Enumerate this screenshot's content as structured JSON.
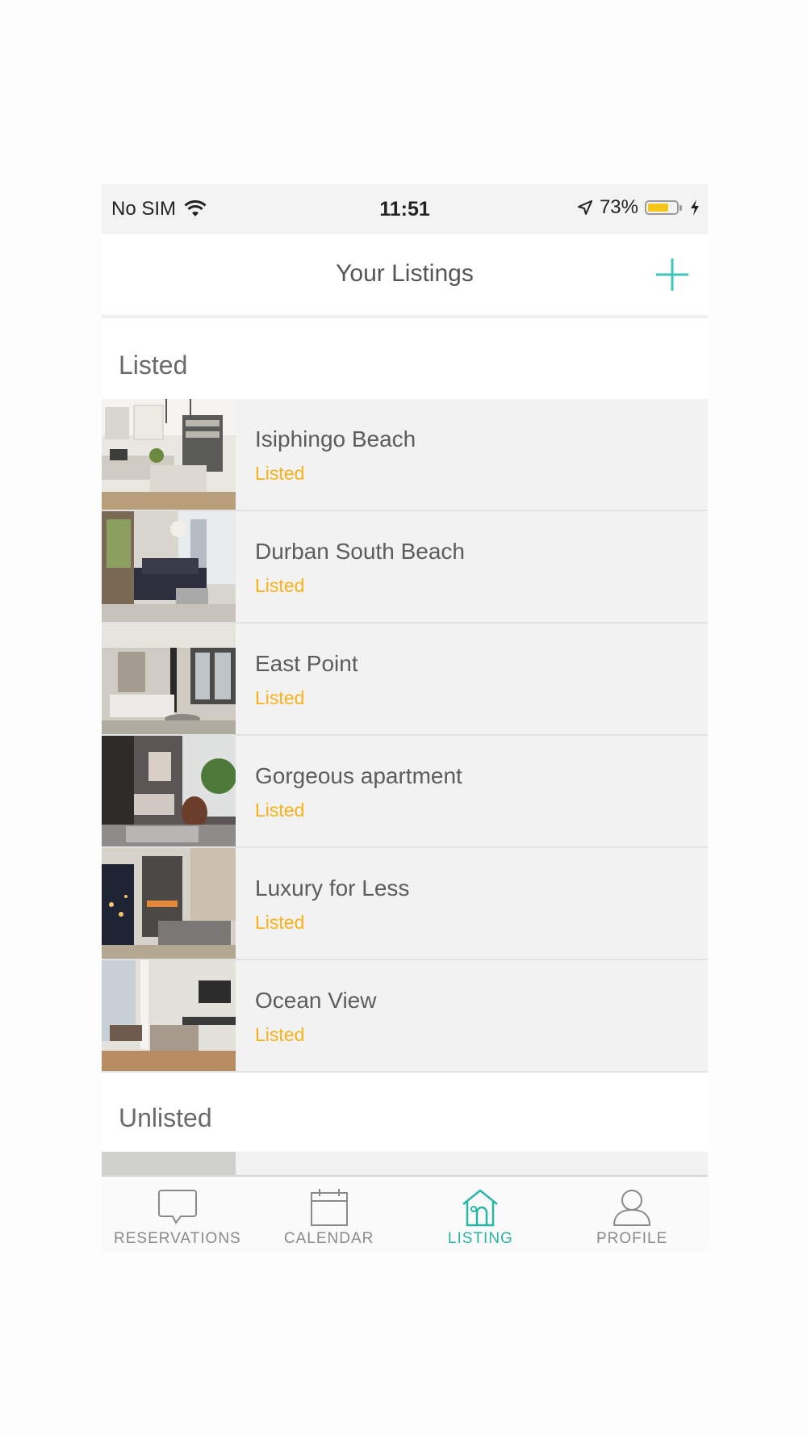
{
  "status_bar": {
    "carrier": "No SIM",
    "time": "11:51",
    "battery_percent": "73%",
    "battery_level": 0.73,
    "battery_color": "#f5c518"
  },
  "nav": {
    "title": "Your Listings",
    "add_icon": "plus-icon",
    "accent_color": "#3cc7b6"
  },
  "sections": {
    "listed_label": "Listed",
    "unlisted_label": "Unlisted"
  },
  "listings": [
    {
      "name": "Isiphingo Beach",
      "status": "Listed",
      "thumbnail": "kitchen-photo"
    },
    {
      "name": "Durban South Beach",
      "status": "Listed",
      "thumbnail": "living-room-photo"
    },
    {
      "name": "East Point",
      "status": "Listed",
      "thumbnail": "living-room-photo"
    },
    {
      "name": "Gorgeous apartment",
      "status": "Listed",
      "thumbnail": "living-room-photo"
    },
    {
      "name": "Luxury for Less",
      "status": "Listed",
      "thumbnail": "living-room-photo"
    },
    {
      "name": "Ocean View",
      "status": "Listed",
      "thumbnail": "living-room-photo"
    }
  ],
  "status_color": "#f7b21b",
  "tabs": [
    {
      "label": "RESERVATIONS",
      "icon": "chat-bubble-icon",
      "active": false
    },
    {
      "label": "CALENDAR",
      "icon": "calendar-icon",
      "active": false
    },
    {
      "label": "LISTING",
      "icon": "house-icon",
      "active": true
    },
    {
      "label": "PROFILE",
      "icon": "person-icon",
      "active": false
    }
  ]
}
